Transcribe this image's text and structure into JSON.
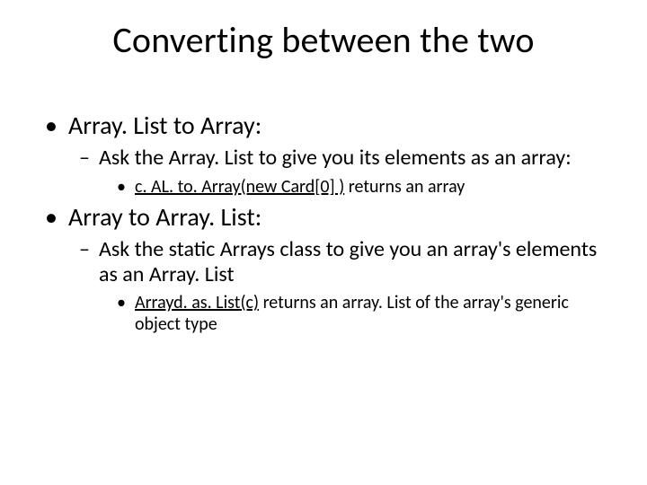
{
  "title": "Converting between the two",
  "b1": {
    "text": "Array. List to Array:",
    "sub1": {
      "text": "Ask the Array. List to give you its elements as an array:",
      "code": "c. AL. to. Array(new Card[0] )",
      "after": " returns an array"
    }
  },
  "b2": {
    "text": "Array to Array. List:",
    "sub1": {
      "text": "Ask the static Arrays class to give you an array's elements as an Array. List",
      "code": "Arrayd. as. List(c)",
      "after": " returns an array. List of the array's generic object type"
    }
  }
}
